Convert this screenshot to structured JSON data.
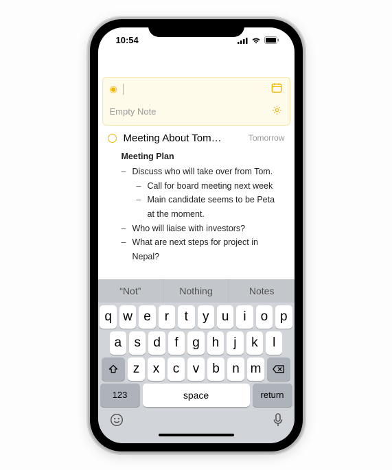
{
  "status": {
    "time": "10:54"
  },
  "compose": {
    "placeholder": "Empty Note"
  },
  "note": {
    "title": "Meeting About Tom…",
    "date": "Tomorrow",
    "heading": "Meeting Plan",
    "b1": "Discuss who will take over from Tom.",
    "b1a": "Call for board meeting next week",
    "b1b": "Main candidate seems to be Peta at the moment.",
    "b2": "Who will liaise with investors?",
    "b3": "What are next steps for project in Nepal?"
  },
  "kb": {
    "s1": "“Not”",
    "s2": "Nothing",
    "s3": "Notes",
    "r1": {
      "k0": "q",
      "k1": "w",
      "k2": "e",
      "k3": "r",
      "k4": "t",
      "k5": "y",
      "k6": "u",
      "k7": "i",
      "k8": "o",
      "k9": "p"
    },
    "r2": {
      "k0": "a",
      "k1": "s",
      "k2": "d",
      "k3": "f",
      "k4": "g",
      "k5": "h",
      "k6": "j",
      "k7": "k",
      "k8": "l"
    },
    "r3": {
      "k0": "z",
      "k1": "x",
      "k2": "c",
      "k3": "v",
      "k4": "b",
      "k5": "n",
      "k6": "m"
    },
    "num": "123",
    "space": "space",
    "ret": "return"
  }
}
